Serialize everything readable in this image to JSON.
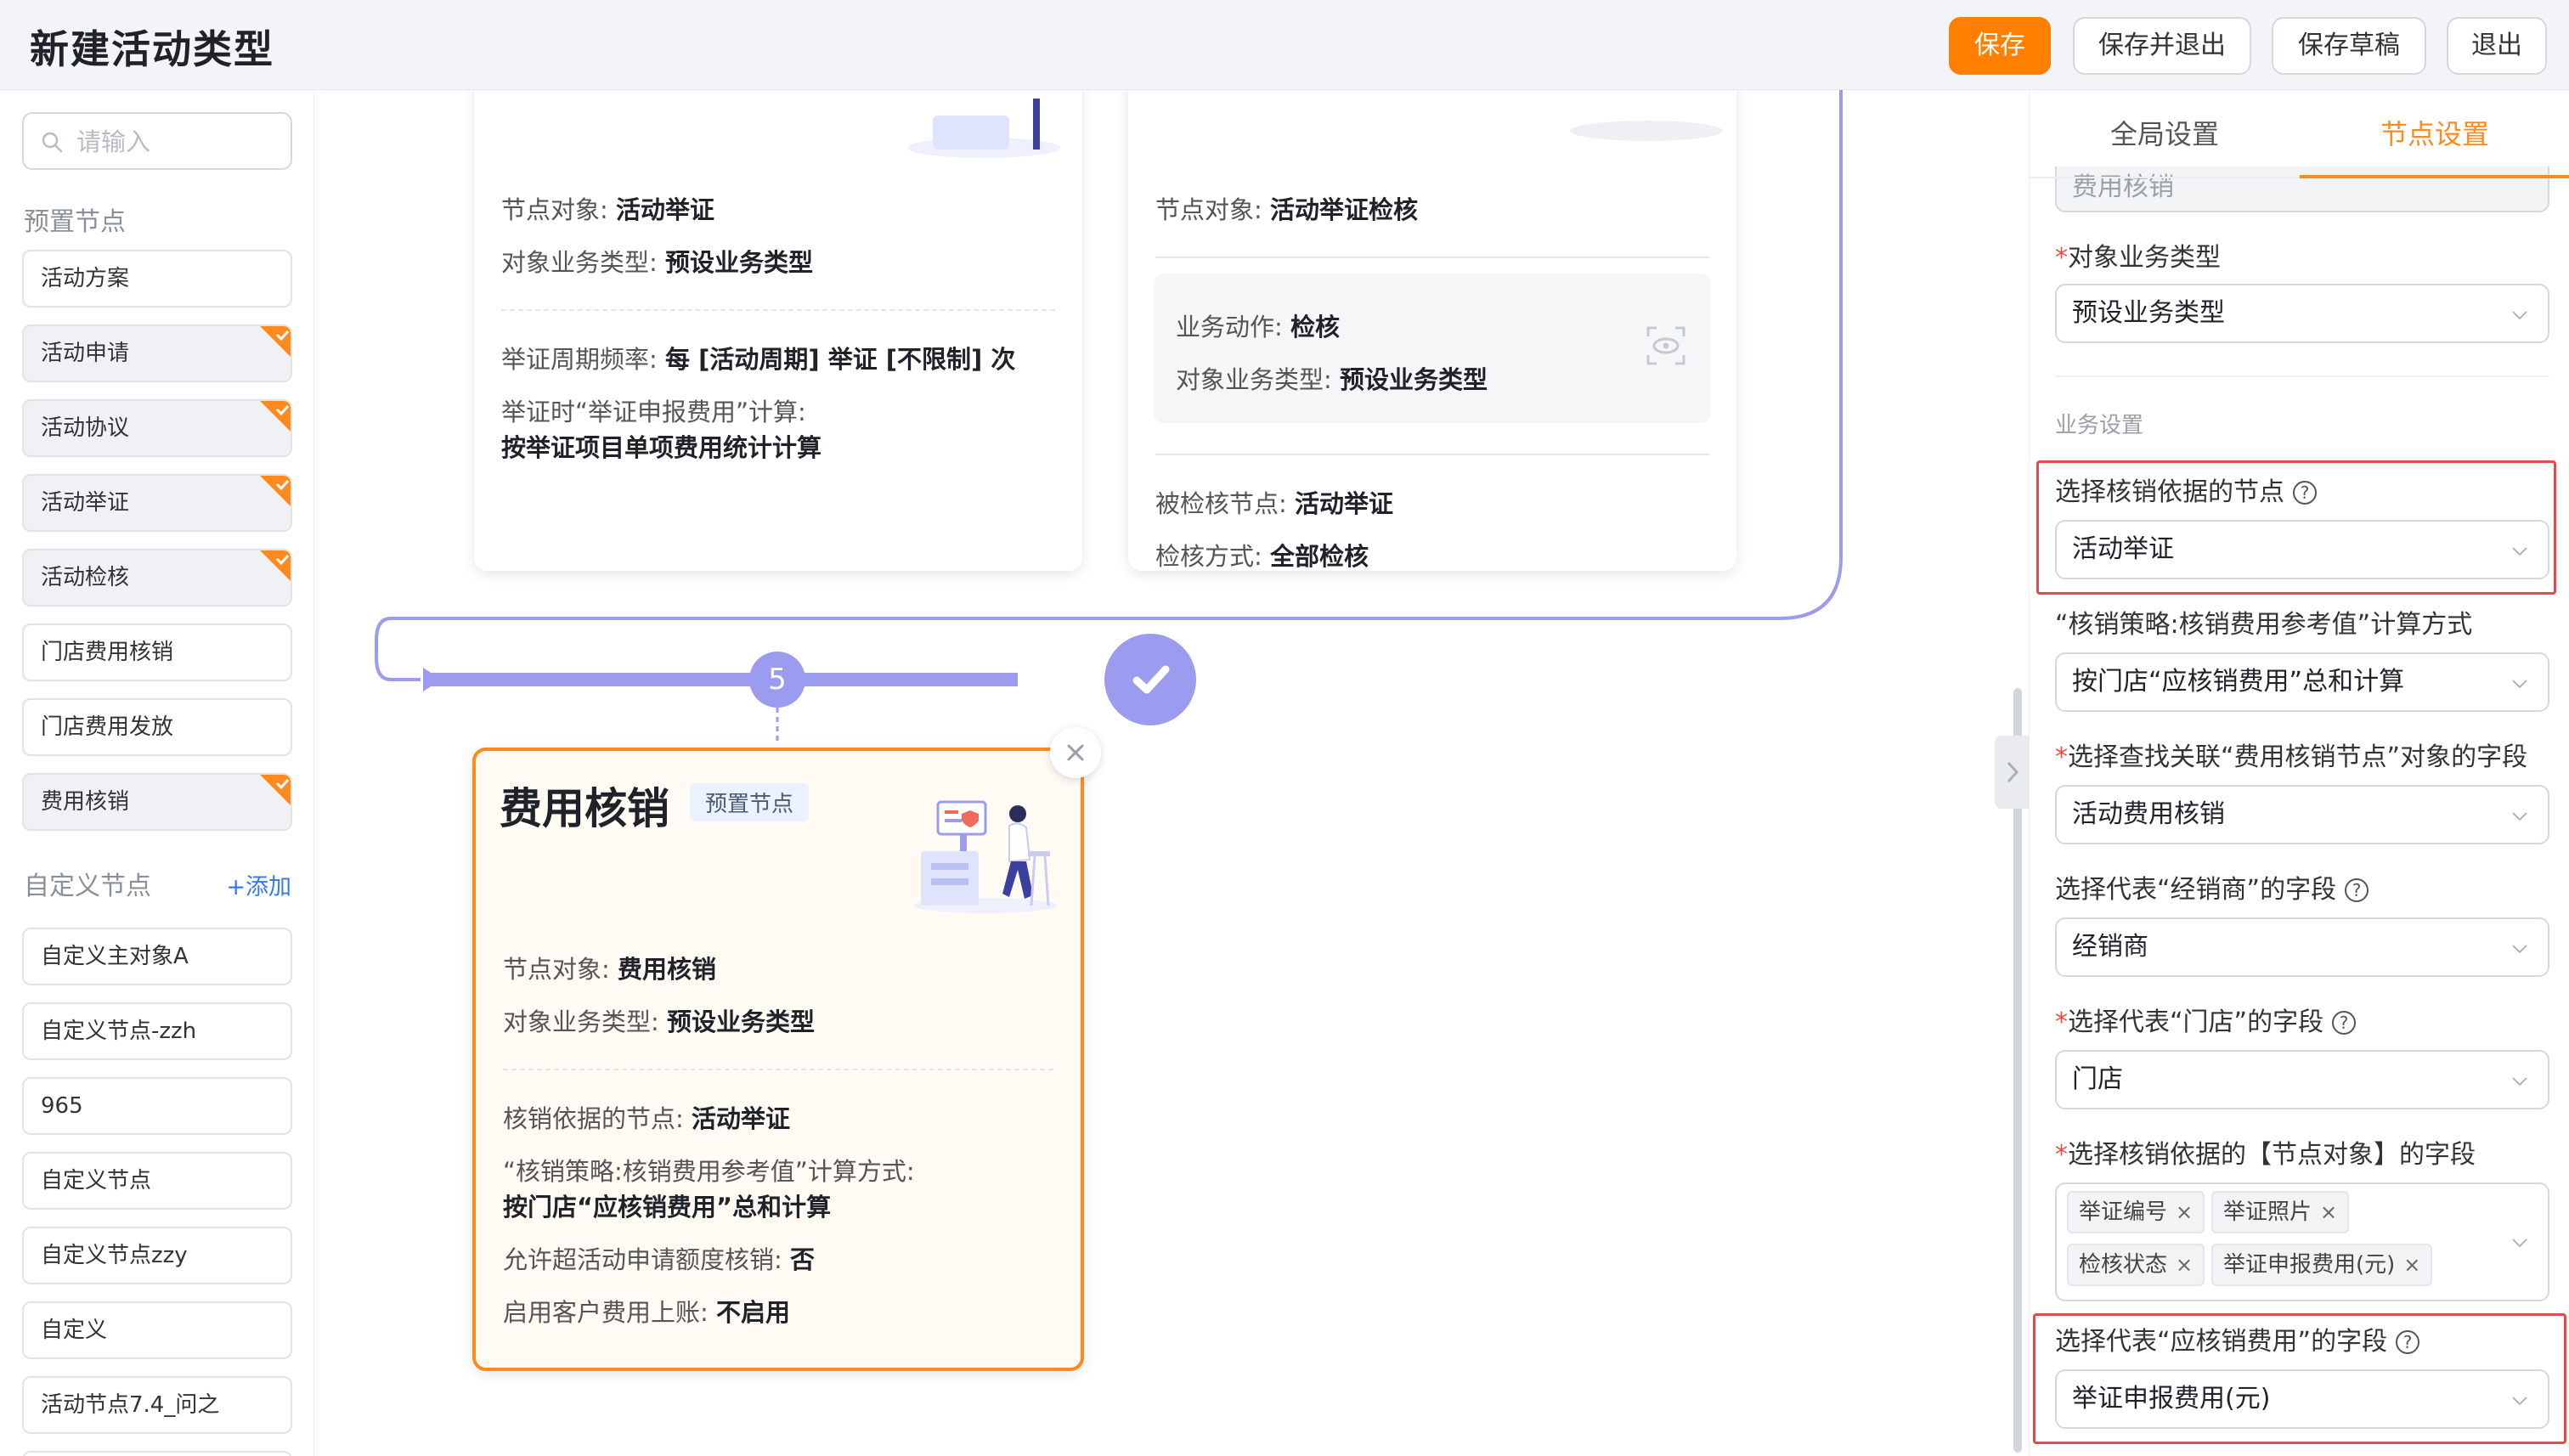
{
  "header": {
    "title": "新建活动类型",
    "buttons": {
      "save": "保存",
      "save_exit": "保存并退出",
      "save_draft": "保存草稿",
      "exit": "退出"
    }
  },
  "sidebar": {
    "search_placeholder": "请输入",
    "preset_label": "预置节点",
    "preset_items": [
      "活动方案",
      "活动申请",
      "活动协议",
      "活动举证",
      "活动检核",
      "门店费用核销",
      "门店费用发放",
      "费用核销"
    ],
    "custom_label": "自定义节点",
    "add_label": "+添加",
    "custom_items": [
      "自定义主对象A",
      "自定义节点-zzh",
      "965",
      "自定义节点",
      "自定义节点zzy",
      "自定义",
      "活动节点7.4_问之"
    ]
  },
  "canvas": {
    "card_proof": {
      "node_object_label": "节点对象: ",
      "node_object": "活动举证",
      "biz_type_label": "对象业务类型: ",
      "biz_type": "预设业务类型",
      "freq_label": "举证周期频率: ",
      "freq": "每 [活动周期] 举证 [不限制] 次",
      "calc_label": "举证时“举证申报费用”计算:",
      "calc_value": "按举证项目单项费用统计计算"
    },
    "card_check": {
      "node_object_label": "节点对象: ",
      "node_object": "活动举证检核",
      "action_label": "业务动作: ",
      "action": "检核",
      "biz_type_label": "对象业务类型: ",
      "biz_type": "预设业务类型",
      "checked_node_label": "被检核节点: ",
      "checked_node": "活动举证",
      "method_label": "检核方式: ",
      "method": "全部检核"
    },
    "step_number": "5",
    "card_writeoff": {
      "title": "费用核销",
      "badge": "预置节点",
      "node_object_label": "节点对象: ",
      "node_object": "费用核销",
      "biz_type_label": "对象业务类型: ",
      "biz_type": "预设业务类型",
      "basis_label": "核销依据的节点: ",
      "basis": "活动举证",
      "strategy_label": "“核销策略:核销费用参考值”计算方式:",
      "strategy_value": "按门店“应核销费用”总和计算",
      "exceed_label": "允许超活动申请额度核销: ",
      "exceed": "否",
      "account_label": "启用客户费用上账: ",
      "account": "不启用"
    }
  },
  "right_panel": {
    "tabs": [
      "全局设置",
      "节点设置"
    ],
    "active_tab": 1,
    "top_field_value": "费用核销",
    "biz_type_label": "对象业务类型",
    "biz_type_value": "预设业务类型",
    "section_title": "业务设置",
    "f1_label": "选择核销依据的节点",
    "f1_value": "活动举证",
    "f2_label": "“核销策略:核销费用参考值”计算方式",
    "f2_value": "按门店“应核销费用”总和计算",
    "f3_label": "选择查找关联“费用核销节点”对象的字段",
    "f3_value": "活动费用核销",
    "f4_label": "选择代表“经销商”的字段",
    "f4_value": "经销商",
    "f5_label": "选择代表“门店”的字段",
    "f5_value": "门店",
    "f6_label": "选择核销依据的【节点对象】的字段",
    "f6_tags": [
      "举证编号",
      "举证照片",
      "检核状态",
      "举证申报费用(元)"
    ],
    "f7_label": "选择代表“应核销费用”的字段",
    "f7_value": "举证申报费用(元)"
  },
  "colors": {
    "accent": "#ff8000",
    "flow": "#9b9cf0",
    "highlight": "#e5484d",
    "required": "#f04b3d",
    "link": "#3478f6"
  }
}
